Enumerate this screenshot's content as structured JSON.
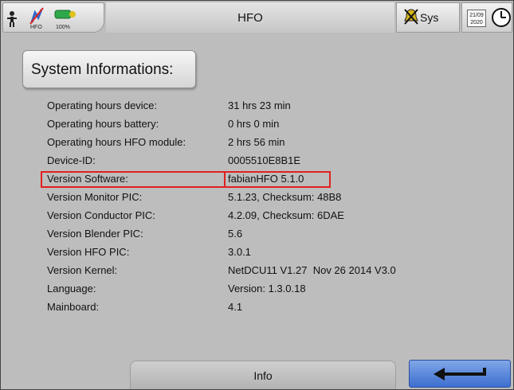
{
  "topbar": {
    "title": "HFO",
    "mode_label": "HFO",
    "battery_percent": "100%",
    "sys_label": "Sys",
    "date_line1": "21/09",
    "date_line2": "2020"
  },
  "section": {
    "heading": "System Informations:"
  },
  "info_rows": [
    {
      "label": "Operating hours device:",
      "value": "31 hrs 23 min"
    },
    {
      "label": "Operating hours battery:",
      "value": "0 hrs 0 min"
    },
    {
      "label": "Operating hours HFO module:",
      "value": "2 hrs 56 min"
    },
    {
      "label": "Device-ID:",
      "value": "0005510E8B1E"
    },
    {
      "label": "Version Software:",
      "value": "fabianHFO 5.1.0"
    },
    {
      "label": "Version Monitor PIC:",
      "value": "5.1.23, Checksum: 48B8"
    },
    {
      "label": "Version Conductor PIC:",
      "value": "4.2.09, Checksum: 6DAE"
    },
    {
      "label": "Version Blender PIC:",
      "value": "5.6"
    },
    {
      "label": "Version HFO PIC:",
      "value": "3.0.1"
    },
    {
      "label": "Version Kernel:",
      "value": "NetDCU11 V1.27  Nov 26 2014 V3.0"
    },
    {
      "label": "Language:",
      "value": "Version: 1.3.0.18"
    },
    {
      "label": "Mainboard:",
      "value": "4.1"
    }
  ],
  "bottombar": {
    "info_tab_label": "Info"
  },
  "colors": {
    "background": "#bdbdbd",
    "highlight_border": "#e0201f",
    "back_button": "#4a7ad6"
  },
  "icons": [
    "patient-icon",
    "hfo-mode-icon",
    "battery-icon",
    "alarm-silenced-icon",
    "clock-icon",
    "back-arrow-icon"
  ]
}
